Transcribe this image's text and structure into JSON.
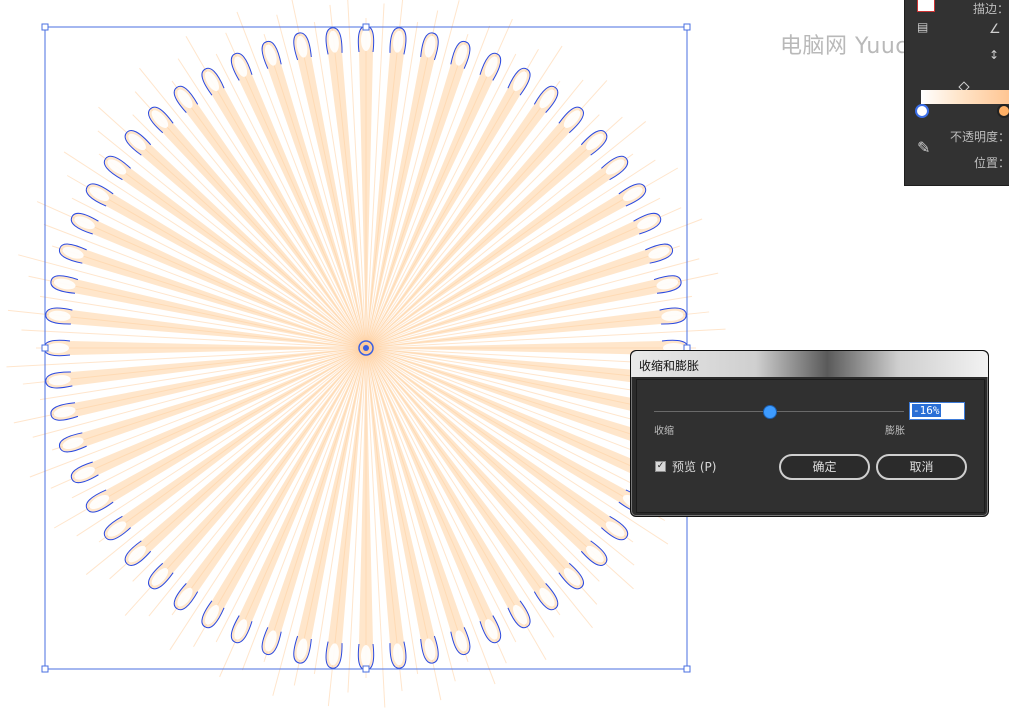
{
  "watermark": "电脑网 Yuuch.com",
  "panel": {
    "stroke_label": "描边：",
    "opacity_label": "不透明度：",
    "position_label": "位置：",
    "gradient_colors": [
      "#ffffff",
      "#ffe6cc",
      "#ffc38e"
    ]
  },
  "artwork": {
    "petal_count": 60,
    "petal_fill": "#ffd1a0",
    "outline_color": "#2a49e0",
    "ray_color": "#ffc78f"
  },
  "dialog": {
    "title": "收缩和膨胀",
    "slider_value": -16,
    "value_text": "-16%",
    "left_label": "收缩",
    "right_label": "膨胀",
    "preview_label": "预览 (P)",
    "preview_checked": true,
    "ok_label": "确定",
    "cancel_label": "取消"
  }
}
